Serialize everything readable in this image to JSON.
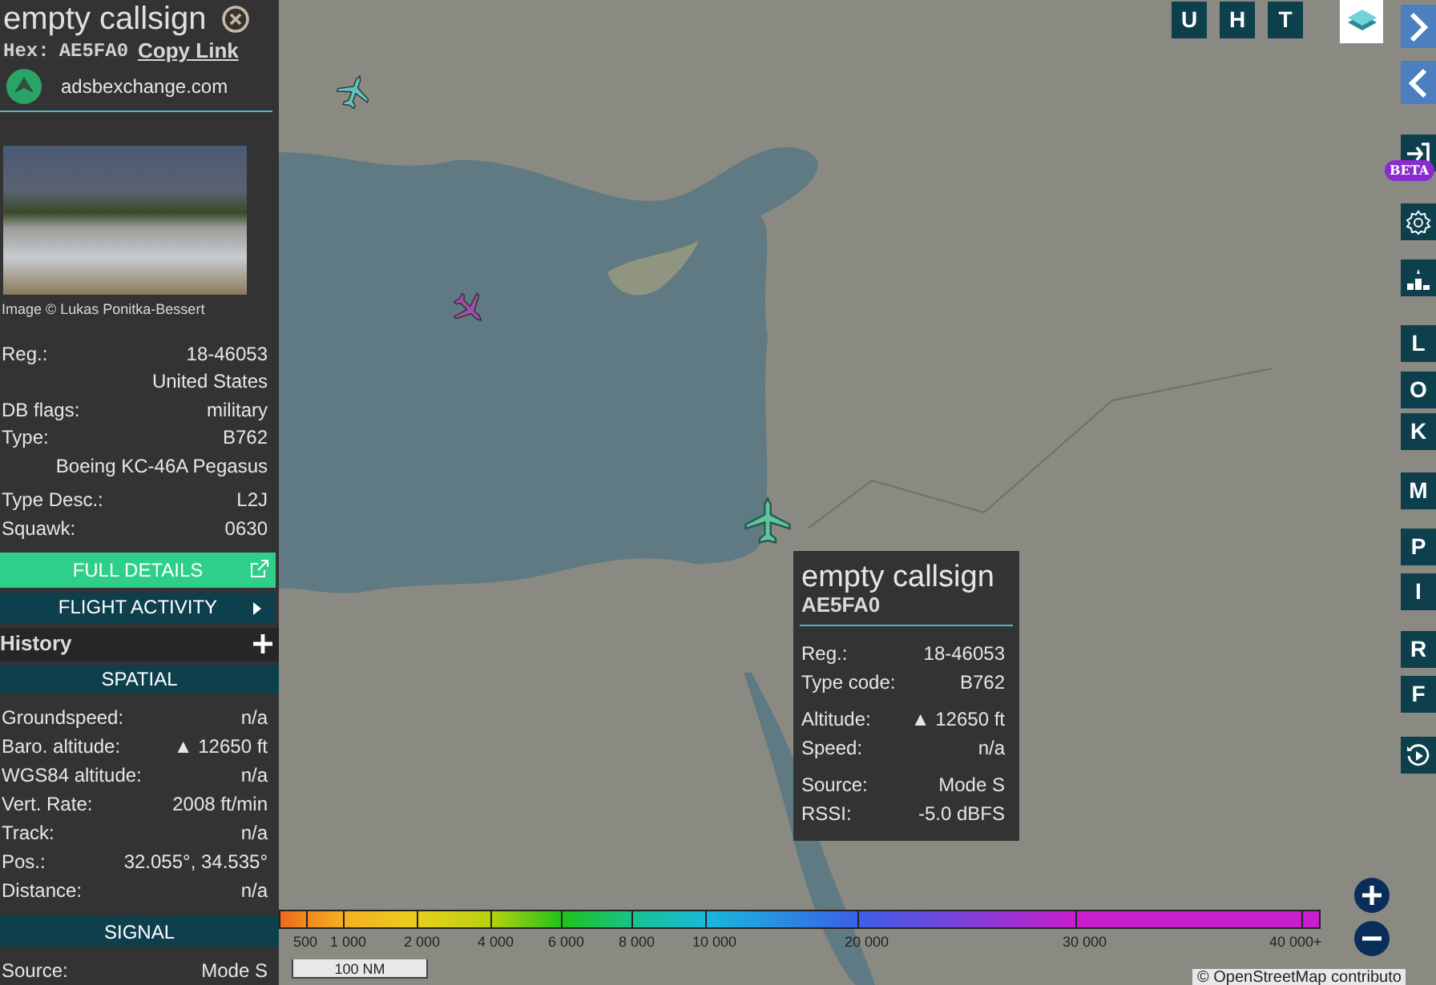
{
  "sidebar": {
    "title": "empty callsign",
    "hex_label": "Hex:",
    "hex": "AE5FA0",
    "copy_link": "Copy Link",
    "site": "adsbexchange.com",
    "photo_credit": "Image © Lukas Ponitka-Bessert",
    "details": [
      {
        "label": "Reg.:",
        "value": "18-46053"
      },
      {
        "value": "United States"
      },
      {
        "label": "DB flags:",
        "value": "military"
      },
      {
        "label": "Type:",
        "value": "B762"
      },
      {
        "value": "Boeing KC-46A Pegasus"
      },
      {
        "label": "Type Desc.:",
        "value": "L2J"
      },
      {
        "label": "Squawk:",
        "value": "0630"
      }
    ],
    "full_details": "FULL DETAILS",
    "flight_activity": "FLIGHT ACTIVITY",
    "history": "History",
    "sections": [
      {
        "title": "SPATIAL",
        "rows": [
          {
            "label": "Groundspeed:",
            "value": "n/a"
          },
          {
            "label": "Baro. altitude:",
            "value": "▲ 12650 ft"
          },
          {
            "label": "WGS84 altitude:",
            "value": "n/a"
          },
          {
            "label": "Vert. Rate:",
            "value": "2008 ft/min"
          },
          {
            "label": "Track:",
            "value": "n/a"
          },
          {
            "label": "Pos.:",
            "value": "32.055°, 34.535°"
          },
          {
            "label": "Distance:",
            "value": "n/a"
          }
        ]
      },
      {
        "title": "SIGNAL",
        "rows": [
          {
            "label": "Source:",
            "value": "Mode S"
          }
        ]
      }
    ]
  },
  "top_buttons": [
    "U",
    "H",
    "T"
  ],
  "side_toolbar": {
    "beta_badge": "BETA",
    "letters": [
      "L",
      "O",
      "K",
      "M",
      "P",
      "I",
      "R",
      "F"
    ]
  },
  "aircraft": [
    {
      "color": "#5fc4c0",
      "selected": false
    },
    {
      "color": "#a04fa8",
      "selected": false
    },
    {
      "color": "#5fc4a0",
      "selected": true
    }
  ],
  "tooltip": {
    "title": "empty callsign",
    "hex": "AE5FA0",
    "groups": [
      [
        {
          "label": "Reg.:",
          "value": "18-46053"
        },
        {
          "label": "Type code:",
          "value": "B762"
        }
      ],
      [
        {
          "label": "Altitude:",
          "value": "▲ 12650 ft"
        },
        {
          "label": "Speed:",
          "value": "n/a"
        }
      ],
      [
        {
          "label": "Source:",
          "value": "Mode S"
        },
        {
          "label": "RSSI:",
          "value": "-5.0 dBFS"
        }
      ]
    ]
  },
  "altitude_legend": [
    "500",
    "1 000",
    "2 000",
    "4 000",
    "6 000",
    "8 000",
    "10 000",
    "20 000",
    "30 000",
    "40 000+"
  ],
  "scale": "100 NM",
  "attribution": "© OpenStreetMap contributo"
}
